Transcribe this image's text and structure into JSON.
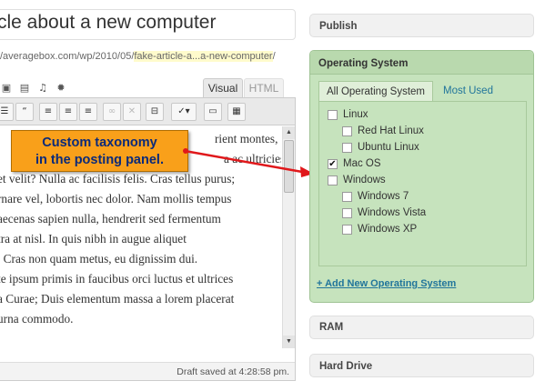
{
  "editor": {
    "title_value": "cle about a new computer",
    "permalink_prefix": "/averagebox.com/wp/2010/05/",
    "permalink_slug": "fake-article-a...a-new-computer",
    "permalink_suffix": "/",
    "media_icons": [
      "image-icon",
      "video-icon",
      "music-icon",
      "gallery-icon"
    ],
    "tabs": {
      "visual": "Visual",
      "html": "HTML"
    },
    "toolbar_icons": [
      "list-icon",
      "blockquote-icon",
      "align-left-icon",
      "align-center-icon",
      "align-right-icon",
      "link-icon",
      "unlink-icon",
      "more-tag-icon",
      "spellcheck-icon",
      "fullscreen-icon",
      "kitchen-sink-icon"
    ],
    "content_lines": [
      "rient montes,",
      "a ac ultricies",
      "et velit? Nulla ac facilisis felis. Cras tellus purus;",
      "rnare vel, lobortis nec dolor. Nam mollis tempus",
      "aecenas sapien nulla, hendrerit sed fermentum",
      "tra at nisl. In quis nibh in augue aliquet",
      ". Cras non quam metus, eu dignissim dui.",
      "te ipsum primis in faucibus orci luctus et ultrices",
      "a Curae; Duis elementum massa a lorem placerat",
      "urna commodo."
    ],
    "status": "Draft saved at 4:28:58 pm."
  },
  "callout": {
    "line1": "Custom taxonomy",
    "line2": "in the posting panel.",
    "fill": "#f9a01a",
    "text_color": "#0a2a7a",
    "arrow_color": "#e0181b"
  },
  "sidebar": {
    "publish": "Publish",
    "os_box": {
      "title": "Operating System",
      "tab_all": "All Operating System",
      "tab_most_used": "Most Used",
      "items": [
        {
          "label": "Linux",
          "checked": false,
          "level": 0
        },
        {
          "label": "Red Hat Linux",
          "checked": false,
          "level": 1
        },
        {
          "label": "Ubuntu Linux",
          "checked": false,
          "level": 1
        },
        {
          "label": "Mac OS",
          "checked": true,
          "level": 0
        },
        {
          "label": "Windows",
          "checked": false,
          "level": 0
        },
        {
          "label": "Windows 7",
          "checked": false,
          "level": 1
        },
        {
          "label": "Windows Vista",
          "checked": false,
          "level": 1
        },
        {
          "label": "Windows XP",
          "checked": false,
          "level": 1
        }
      ],
      "add_new": "+ Add New Operating System",
      "bg_color": "#c6e3bd"
    },
    "ram": "RAM",
    "hard_drive": "Hard Drive"
  }
}
